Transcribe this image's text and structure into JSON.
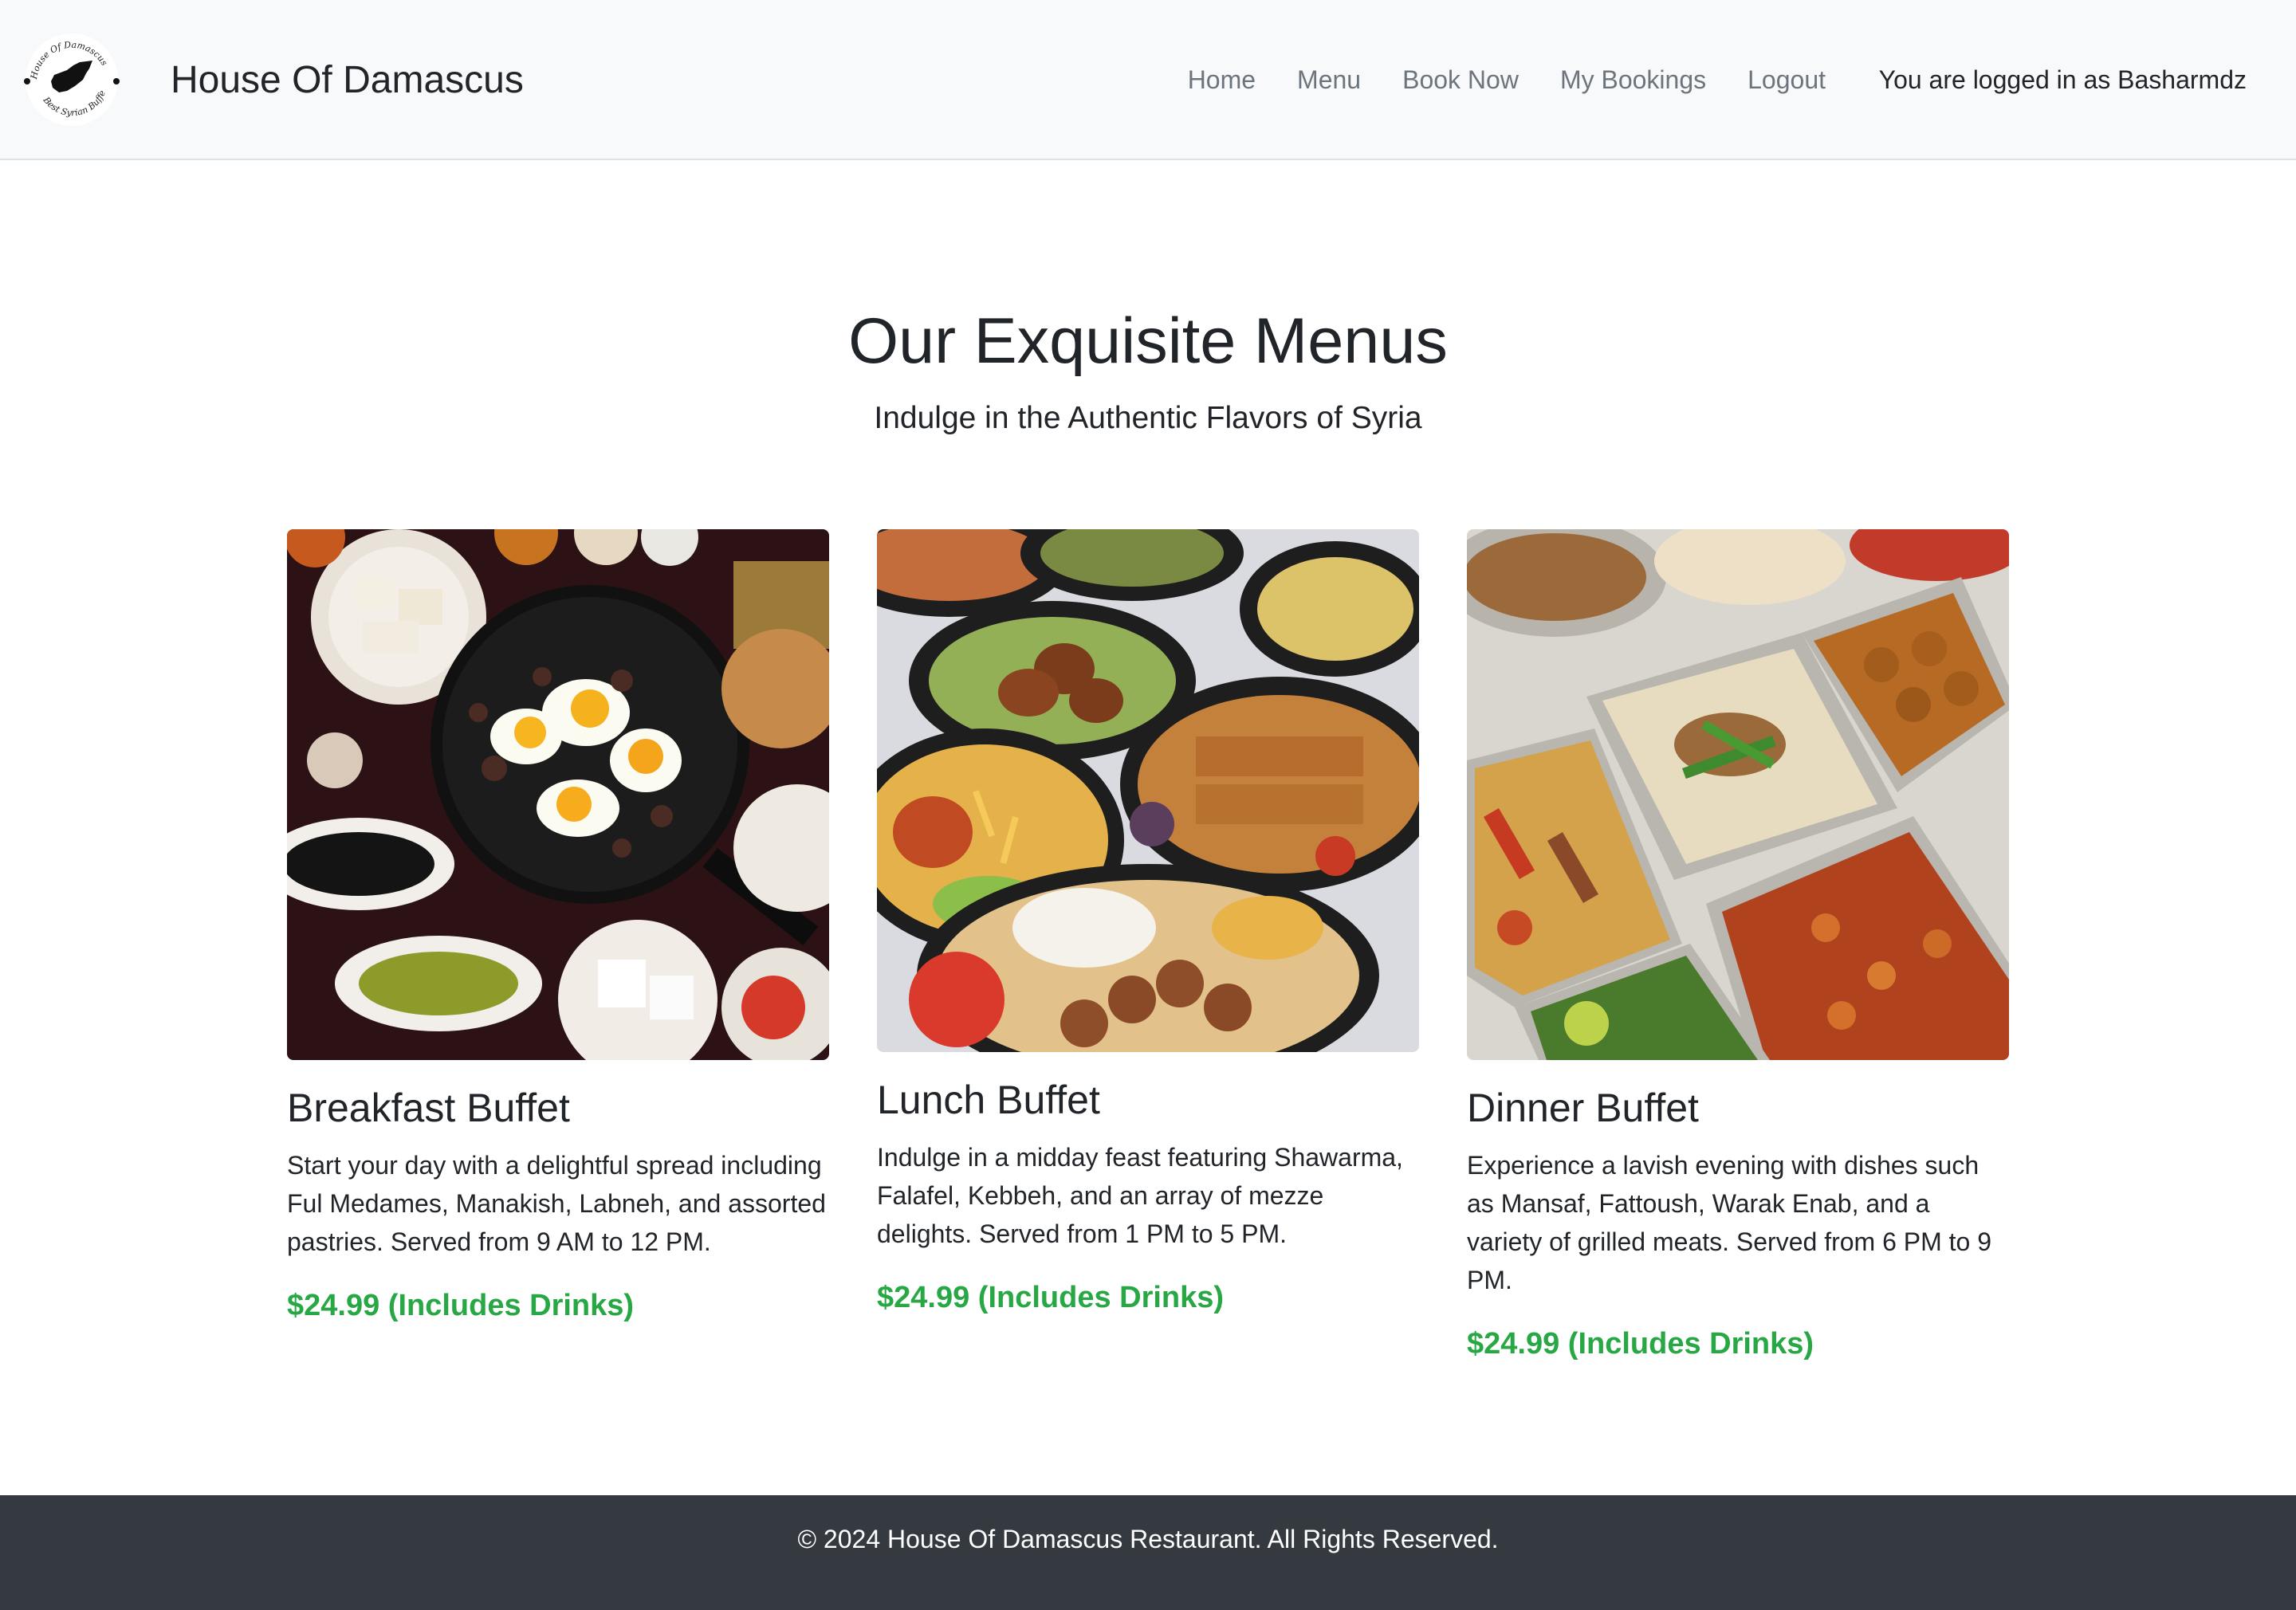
{
  "navbar": {
    "brand_name": "House Of Damascus",
    "logo_text_top": "House Of Damascus",
    "logo_text_bottom": "Best Syrian Buffet",
    "links": [
      "Home",
      "Menu",
      "Book Now",
      "My Bookings",
      "Logout"
    ],
    "logged_in_text": "You are logged in as Basharmdz"
  },
  "hero": {
    "title": "Our Exquisite Menus",
    "subtitle": "Indulge in the Authentic Flavors of Syria"
  },
  "menus": [
    {
      "image": "breakfast-spread-photo",
      "title": "Breakfast Buffet",
      "description": "Start your day with a delightful spread including Ful Medames, Manakish, Labneh, and assorted pastries. Served from 9 AM to 12 PM.",
      "price": "$24.99 (Includes Drinks)"
    },
    {
      "image": "lunch-platter-photo",
      "title": "Lunch Buffet",
      "description": "Indulge in a midday feast featuring Shawarma, Falafel, Kebbeh, and an array of mezze delights. Served from 1 PM to 5 PM.",
      "price": "$24.99 (Includes Drinks)"
    },
    {
      "image": "dinner-trays-photo",
      "title": "Dinner Buffet",
      "description": "Experience a lavish evening with dishes such as Mansaf, Fattoush, Warak Enab, and a variety of grilled meats. Served from 6 PM to 9 PM.",
      "price": "$24.99 (Includes Drinks)"
    }
  ],
  "footer": {
    "text": "© 2024 House Of Damascus Restaurant. All Rights Reserved."
  },
  "colors": {
    "navbar_bg": "#f8f9fa",
    "nav_link": "#6c757d",
    "price_green": "#28a745",
    "footer_bg": "#343a40"
  }
}
